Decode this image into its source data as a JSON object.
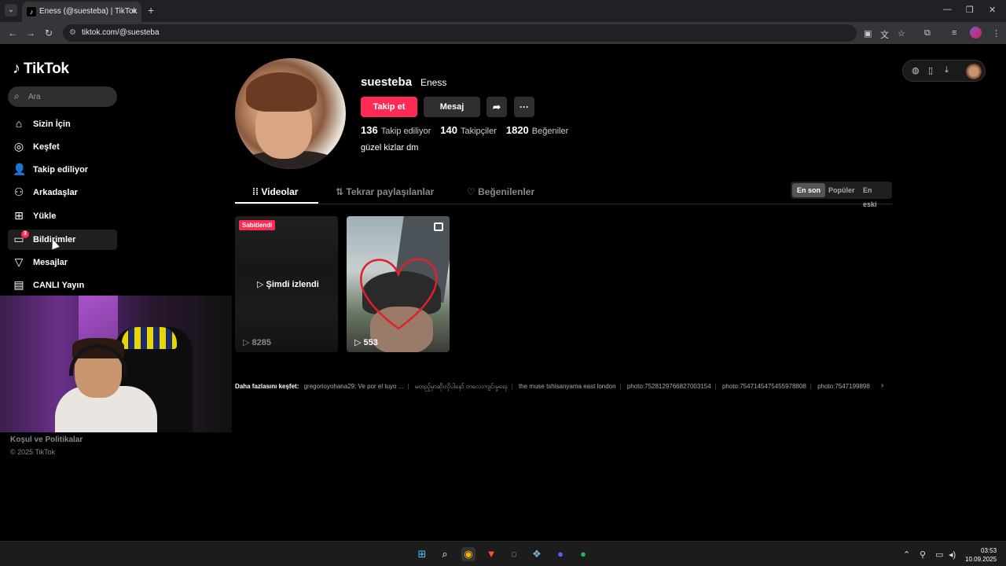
{
  "browser": {
    "tab_title": "Eness (@suesteba) | TikTok",
    "url": "tiktok.com/@suesteba"
  },
  "sidebar": {
    "logo": "TikTok",
    "search_placeholder": "Ara",
    "items": [
      {
        "label": "Sizin İçin",
        "icon": "home-icon"
      },
      {
        "label": "Keşfet",
        "icon": "compass-icon"
      },
      {
        "label": "Takip ediliyor",
        "icon": "user-follow-icon"
      },
      {
        "label": "Arkadaşlar",
        "icon": "friends-icon"
      },
      {
        "label": "Yükle",
        "icon": "upload-icon"
      },
      {
        "label": "Bildirimler",
        "icon": "notification-icon",
        "badge": "3"
      },
      {
        "label": "Mesajlar",
        "icon": "message-icon"
      },
      {
        "label": "CANLI Yayın",
        "icon": "live-icon"
      }
    ],
    "footer_links": "Koşul ve Politikalar",
    "footer_copy": "© 2025 TikTok"
  },
  "profile": {
    "username": "suesteba",
    "nickname": "Eness",
    "follow_label": "Takip et",
    "message_label": "Mesaj",
    "stats": {
      "following": "136",
      "following_label": "Takip ediliyor",
      "followers": "140",
      "followers_label": "Takipçiler",
      "likes": "1820",
      "likes_label": "Beğeniler"
    },
    "bio": "güzel kizlar dm"
  },
  "tabs": {
    "videos": "Videolar",
    "reposts": "Tekrar paylaşılanlar",
    "liked": "Beğenilenler"
  },
  "sort": {
    "latest": "En son",
    "popular": "Popüler",
    "oldest": "En eski"
  },
  "videos": [
    {
      "pinned_label": "Sabitlendi",
      "watched_label": "Şimdi izlendi",
      "views": "8285"
    },
    {
      "views": "553"
    }
  ],
  "explore": {
    "label": "Daha fazlasını keşfet:",
    "links": [
      "gregorioyohana29: Ve por el tuyo ...",
      "မတည့်မှာဆိုးလိုပါနော် တလေးကျင်းမှုရေး",
      "the muse tshisanyama east london",
      "photo:7528129766827003154",
      "photo:7547145475455978808",
      "photo:7547199898"
    ]
  },
  "taskbar": {
    "time": "03:53",
    "date": "10.09.2025"
  },
  "colors": {
    "accent": "#fe2c55",
    "background": "#000000",
    "surface": "#2f2f2f"
  }
}
